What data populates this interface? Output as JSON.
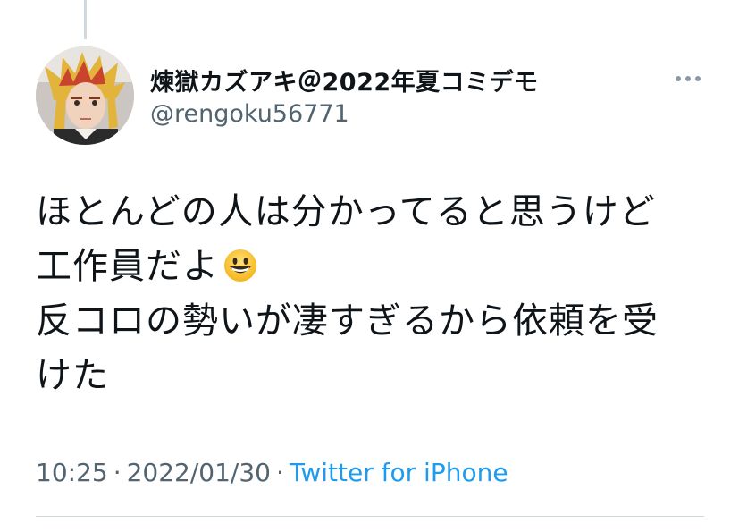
{
  "tweet": {
    "display_name": "煉獄カズアキ＠2022年夏コミデモ",
    "handle": "@rengoku56771",
    "lines": [
      "ほとんどの人は分かってると思うけど",
      "工作員だよ",
      "反コロの勢いが凄すぎるから依頼を受",
      "けた"
    ],
    "emoji": "grinning-face-emoji",
    "time": "10:25",
    "separator": "·",
    "date": "2022/01/30",
    "source": "Twitter for iPhone"
  },
  "colors": {
    "text": "#0f1419",
    "secondary": "#536471",
    "link": "#1d9bf0",
    "divider": "#cfd9de"
  },
  "icons": {
    "more": "more-horizontal-icon",
    "avatar": "profile-avatar"
  }
}
